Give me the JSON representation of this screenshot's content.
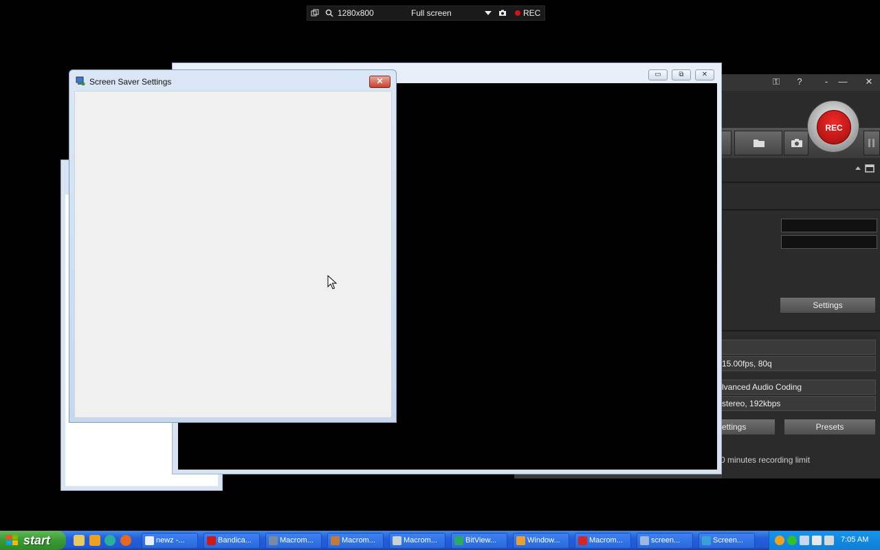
{
  "recorder_bar": {
    "size_label": "1280x800",
    "mode_label": "Full screen",
    "rec_label": "REC"
  },
  "screensaver_window": {
    "title": "Screen Saver Settings",
    "close_glyph": "✕"
  },
  "preview_window": {
    "minimize_glyph": "▭",
    "restore_glyph": "⧉",
    "close_glyph": "✕"
  },
  "bandicam": {
    "titlebar": {
      "key_glyph": "⚿",
      "help_glyph": "?",
      "dash_glyph": "-",
      "minimize_glyph": "—",
      "close_glyph": "✕"
    },
    "rec_button_label": "REC",
    "settings_button": "Settings",
    "video_format": "15.00fps, 80q",
    "audio_codec": "lvanced Audio Coding",
    "audio_format": "stereo, 192kbps",
    "settings_button_2": "ettings",
    "presets_button": "Presets",
    "limit_note": "0 minutes recording limit"
  },
  "taskbar": {
    "start_label": "start",
    "tasks": [
      {
        "label": "newz -...",
        "icon_color": "#e8eefa"
      },
      {
        "label": "Bandica...",
        "icon_color": "#d01818"
      },
      {
        "label": "Macrom...",
        "icon_color": "#7a8aa0"
      },
      {
        "label": "Macrom...",
        "icon_color": "#c07a3a"
      },
      {
        "label": "Macrom...",
        "icon_color": "#c8d0d8"
      },
      {
        "label": "BitView...",
        "icon_color": "#29a86a"
      },
      {
        "label": "Window...",
        "icon_color": "#e8a030"
      },
      {
        "label": "Macrom...",
        "icon_color": "#d02828"
      },
      {
        "label": "screen...",
        "icon_color": "#9ab8e0"
      },
      {
        "label": "Screen...",
        "icon_color": "#3aa0d8"
      }
    ],
    "clock": "7:05 AM"
  },
  "colors": {
    "desktop": "#000000",
    "taskbar_blue": "#245edc",
    "rec_red": "#d01010"
  }
}
